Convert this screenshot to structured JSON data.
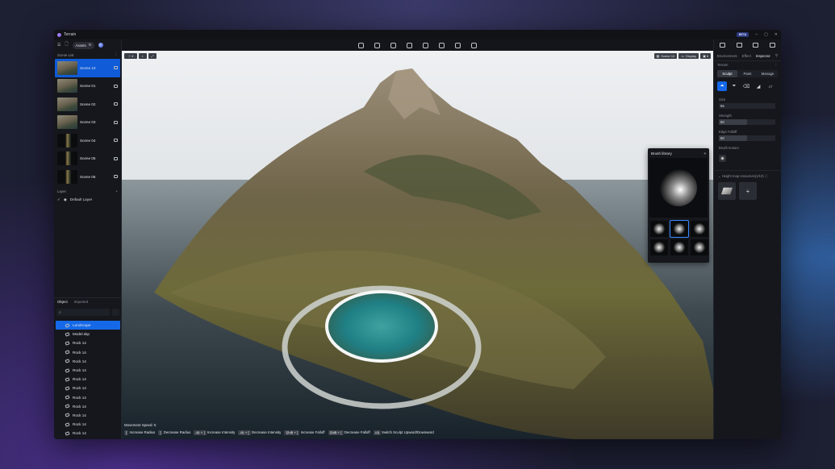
{
  "app": {
    "title": "Terrain",
    "badge": "BETA"
  },
  "left": {
    "assets_label": "Assets",
    "scene_list_label": "Scene List",
    "scenes": [
      {
        "label": "Scene 10",
        "selected": true,
        "thumb": "landscape"
      },
      {
        "label": "Scene 01",
        "selected": false,
        "thumb": "landscape"
      },
      {
        "label": "Scene 02",
        "selected": false,
        "thumb": "landscape"
      },
      {
        "label": "Scene 03",
        "selected": false,
        "thumb": "landscape"
      },
      {
        "label": "Scene 04",
        "selected": false,
        "thumb": "dark"
      },
      {
        "label": "Scene 05",
        "selected": false,
        "thumb": "dark"
      },
      {
        "label": "Scene 06",
        "selected": false,
        "thumb": "dark"
      }
    ],
    "layer_label": "Layer",
    "default_layer": "Default Layer",
    "object_tab": "Object",
    "imported_tab": "Imported",
    "objects": [
      "Landscape",
      "Model.skp",
      "Rock 14",
      "Rock 14",
      "Rock 14",
      "Rock 14",
      "Rock 14",
      "Rock 14",
      "Rock 14",
      "Rock 14",
      "Rock 14",
      "Rock 14",
      "Rock 14",
      "Rock 14"
    ]
  },
  "viewport": {
    "scene_chip": "Scene 10",
    "display_chip": "Display",
    "brush_library": {
      "title": "Brush library",
      "selected_index": 1,
      "count": 6
    },
    "movement_speed": "Movement Speed: 5",
    "hints": [
      {
        "key": "[",
        "text": "Increase Radius"
      },
      {
        "key": "]",
        "text": "Decrease Radius"
      },
      {
        "key": "Alt + ]",
        "text": "Increase Intensity"
      },
      {
        "key": "Alt + [",
        "text": "Decrease Intensity"
      },
      {
        "key": "Shift + ]",
        "text": "Increase Falloff"
      },
      {
        "key": "Shift + [",
        "text": "Decrease Falloff"
      },
      {
        "key": "Alt",
        "text": "Switch Sculpt Upward/Downward"
      }
    ]
  },
  "right": {
    "tabs": [
      "Environment",
      "Effect",
      "Inspector"
    ],
    "active_tab": "Inspector",
    "section": "Terrain",
    "modes": [
      "Sculpt",
      "Paint",
      "Manage"
    ],
    "active_mode": "Sculpt",
    "size_label": "Size",
    "size_value": "55",
    "strength_label": "Strength",
    "strength_value": "50",
    "strength_fill": 0.5,
    "falloff_label": "Edge Falloff",
    "falloff_value": "50",
    "falloff_fill": 0.5,
    "brush_texture_label": "Brush texture",
    "heightmap_label": "Height map resources(1/10)"
  }
}
